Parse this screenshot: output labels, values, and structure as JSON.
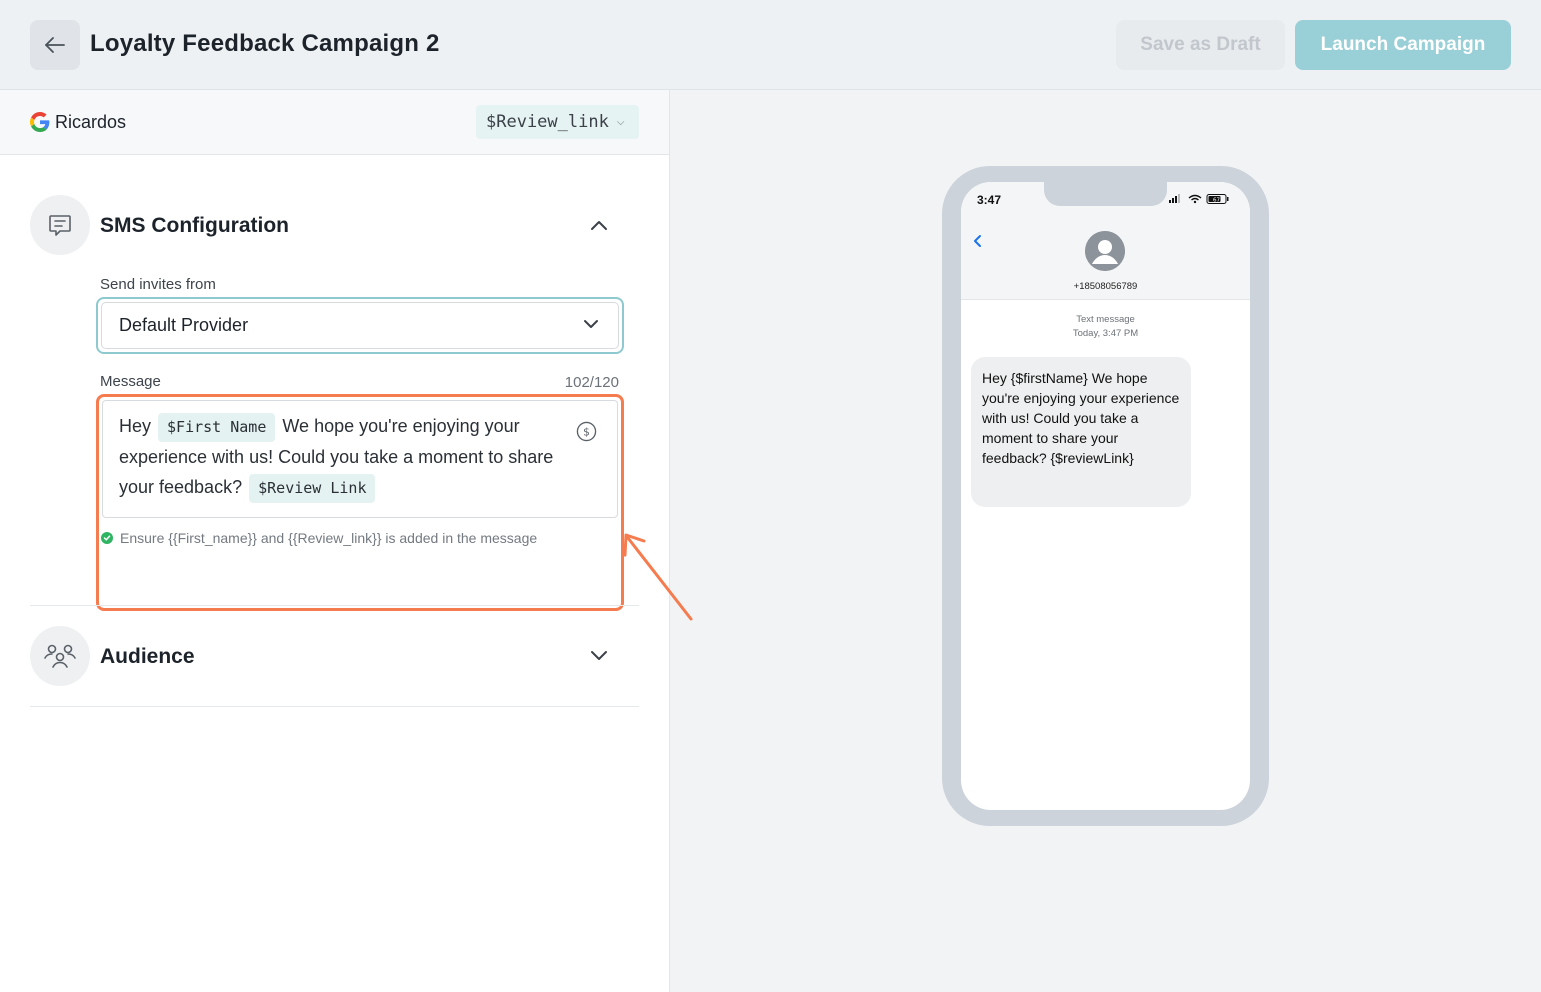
{
  "header": {
    "title": "Loyalty Feedback Campaign 2",
    "save_draft_label": "Save as Draft",
    "launch_label": "Launch Campaign"
  },
  "business": {
    "name": "Ricardos",
    "review_link_token": "$Review_link"
  },
  "sms_section": {
    "title": "SMS Configuration",
    "send_from_label": "Send invites from",
    "provider_value": "Default Provider",
    "message_label": "Message",
    "char_count": "102/120",
    "message": {
      "prefix": "Hey",
      "first_name_chip": "$First Name",
      "body": "We hope you're enjoying your experience with us! Could you take a moment to share your feedback?",
      "review_link_chip": "$Review Link"
    },
    "hint": "Ensure {{First_name}} and {{Review_link}} is added in the message"
  },
  "audience_section": {
    "title": "Audience"
  },
  "phone_preview": {
    "time": "3:47",
    "battery": "67",
    "phone_number": "+18508056789",
    "meta_type": "Text message",
    "meta_time": "Today, 3:47 PM",
    "bubble_text": "Hey {$firstName} We hope you're enjoying your experience with us! Could you take a moment to share your feedback? {$reviewLink}"
  },
  "colors": {
    "accent": "#99cfd6",
    "highlight": "#f47c4f",
    "success": "#2fb562"
  }
}
